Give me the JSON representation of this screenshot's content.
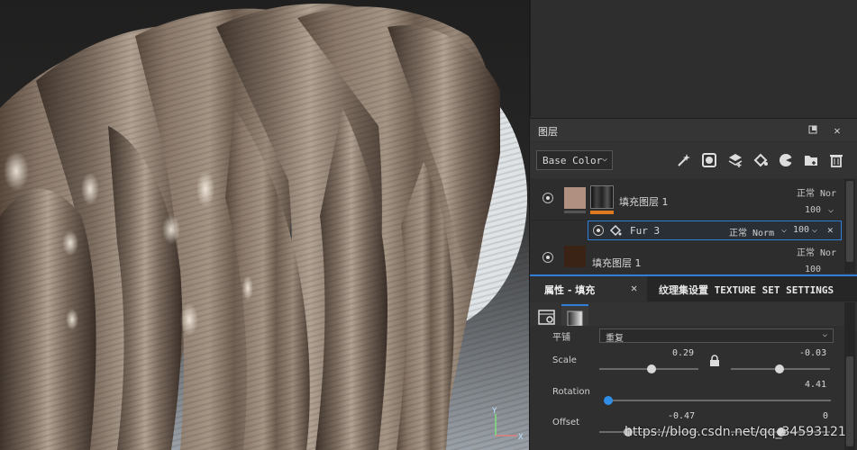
{
  "layers_panel": {
    "title": "图层",
    "channel": "Base Color",
    "layers": [
      {
        "name": "填充图层 1",
        "blend": "正常 Nor",
        "opacity": "100"
      },
      {
        "name": "填充图层 1",
        "blend": "正常 Nor",
        "opacity": "100"
      }
    ],
    "effect": {
      "name": "Fur 3",
      "blend": "正常 Norm",
      "opacity": "100"
    }
  },
  "properties": {
    "tab_title": "属性 - 填充",
    "texture_set_tab": "纹理集设置 TEXTURE SET SETTINGS",
    "tiling_label": "平铺",
    "tiling_value": "重复",
    "scale_label": "Scale",
    "scale_u": "0.29",
    "scale_v": "-0.03",
    "scale_u_fraction": 0.53,
    "scale_v_fraction": 0.49,
    "rotation_label": "Rotation",
    "rotation_value": "4.41",
    "rotation_fraction": 0.01,
    "offset_label": "Offset",
    "offset_u": "-0.47",
    "offset_v": "0"
  },
  "viewport": {
    "axis_y": "Y",
    "axis_x": "X"
  },
  "watermark": "https://blog.csdn.net/qq_34593121",
  "colors": {
    "accent": "#2f7fd8",
    "orange": "#e07a20"
  }
}
